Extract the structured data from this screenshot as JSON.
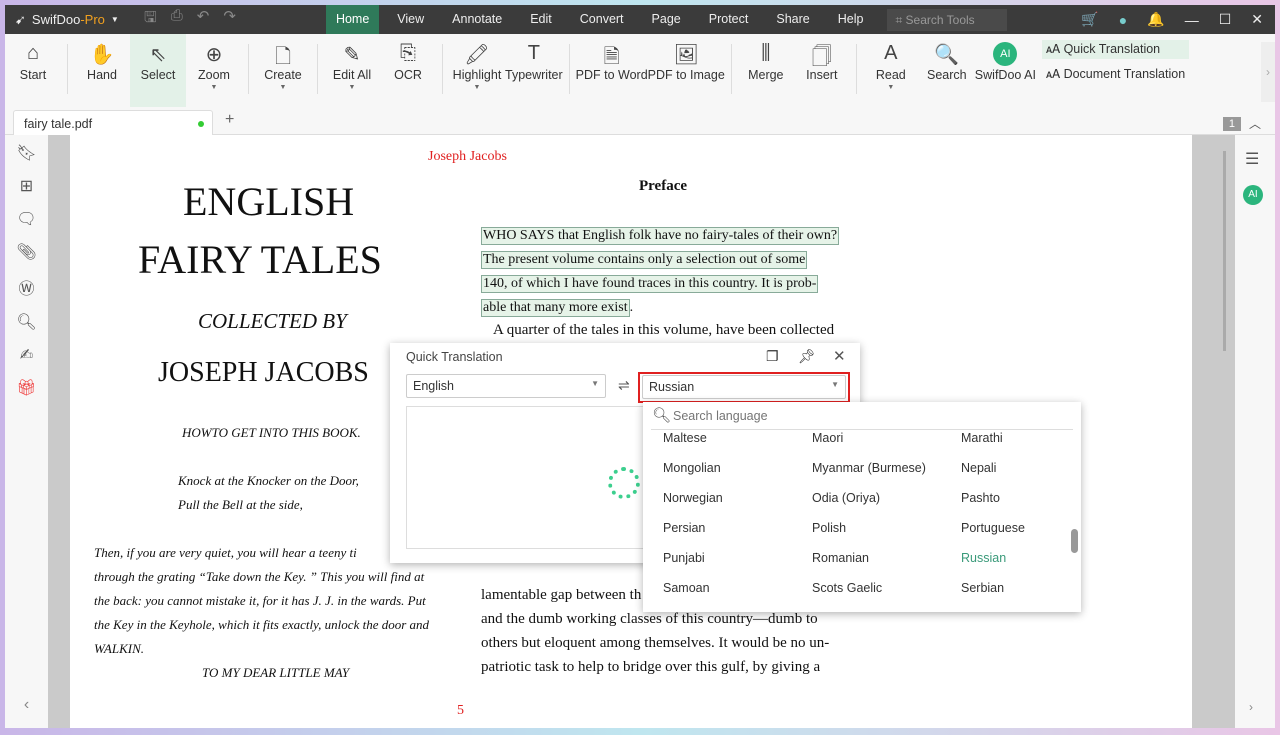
{
  "app": {
    "name": "SwifDoo",
    "name_suffix": "-Pro"
  },
  "menu": [
    "Home",
    "View",
    "Annotate",
    "Edit",
    "Convert",
    "Page",
    "Protect",
    "Share",
    "Help"
  ],
  "search_tools_placeholder": "Search Tools",
  "toolbar": [
    "Start",
    "Hand",
    "Select",
    "Zoom",
    "Create",
    "Edit All",
    "OCR",
    "Highlight",
    "Typewriter",
    "PDF to Word",
    "PDF to Image",
    "Merge",
    "Insert",
    "Read",
    "Search",
    "SwifDoo AI"
  ],
  "translation": {
    "quick": "Quick Translation",
    "document": "Document Translation"
  },
  "tab": {
    "name": "fairy tale.pdf",
    "page_indicator": "1"
  },
  "document": {
    "author_header": "Joseph Jacobs",
    "title1": "ENGLISH",
    "title2": "FAIRY TALES",
    "collected": "COLLECTED BY",
    "author": "JOSEPH JACOBS",
    "howto": "HOWTO GET INTO THIS BOOK.",
    "knock1": "Knock at the Knocker on the Door,",
    "knock2": "Pull the Bell at the side,",
    "left_para": [
      "Then, if you are very quiet, you will hear a teeny ti",
      "through the grating “Take down the Key. ” This you will find at",
      "the back: you cannot mistake it, for it has J. J. in the wards. Put",
      "the Key in the Keyhole, which it fits exactly, unlock the door and",
      "WALKIN."
    ],
    "dedication": "TO MY DEAR LITTLE MAY",
    "preface": "Preface",
    "highlighted": [
      "WHO SAYS that English folk have no fairy-tales of their own?",
      "The present volume contains only a selection out of some",
      "140, of which I have found traces in this country. It is prob-",
      "able that many more exist"
    ],
    "right_para": [
      "A quarter of the tales in this volume, have been collected"
    ],
    "right_bottom": [
      "lamentable gap between th",
      "and the dumb working classes of this country—dumb to",
      "others but eloquent among themselves. It would be no un-",
      "patriotic task to help to bridge over this gulf, by giving a"
    ],
    "page_number": "5"
  },
  "dialog": {
    "title": "Quick Translation",
    "source": "English",
    "target": "Russian",
    "search_placeholder": "Search language",
    "languages": [
      [
        "Maltese",
        "Maori",
        "Marathi"
      ],
      [
        "Mongolian",
        "Myanmar (Burmese)",
        "Nepali"
      ],
      [
        "Norwegian",
        "Odia (Oriya)",
        "Pashto"
      ],
      [
        "Persian",
        "Polish",
        "Portuguese"
      ],
      [
        "Punjabi",
        "Romanian",
        "Russian"
      ],
      [
        "Samoan",
        "Scots Gaelic",
        "Serbian"
      ]
    ],
    "selected": "Russian"
  },
  "colors": {
    "accent": "#2f7a5a",
    "highlight_red": "#e02020",
    "selected_lang": "#3a9a7a"
  }
}
